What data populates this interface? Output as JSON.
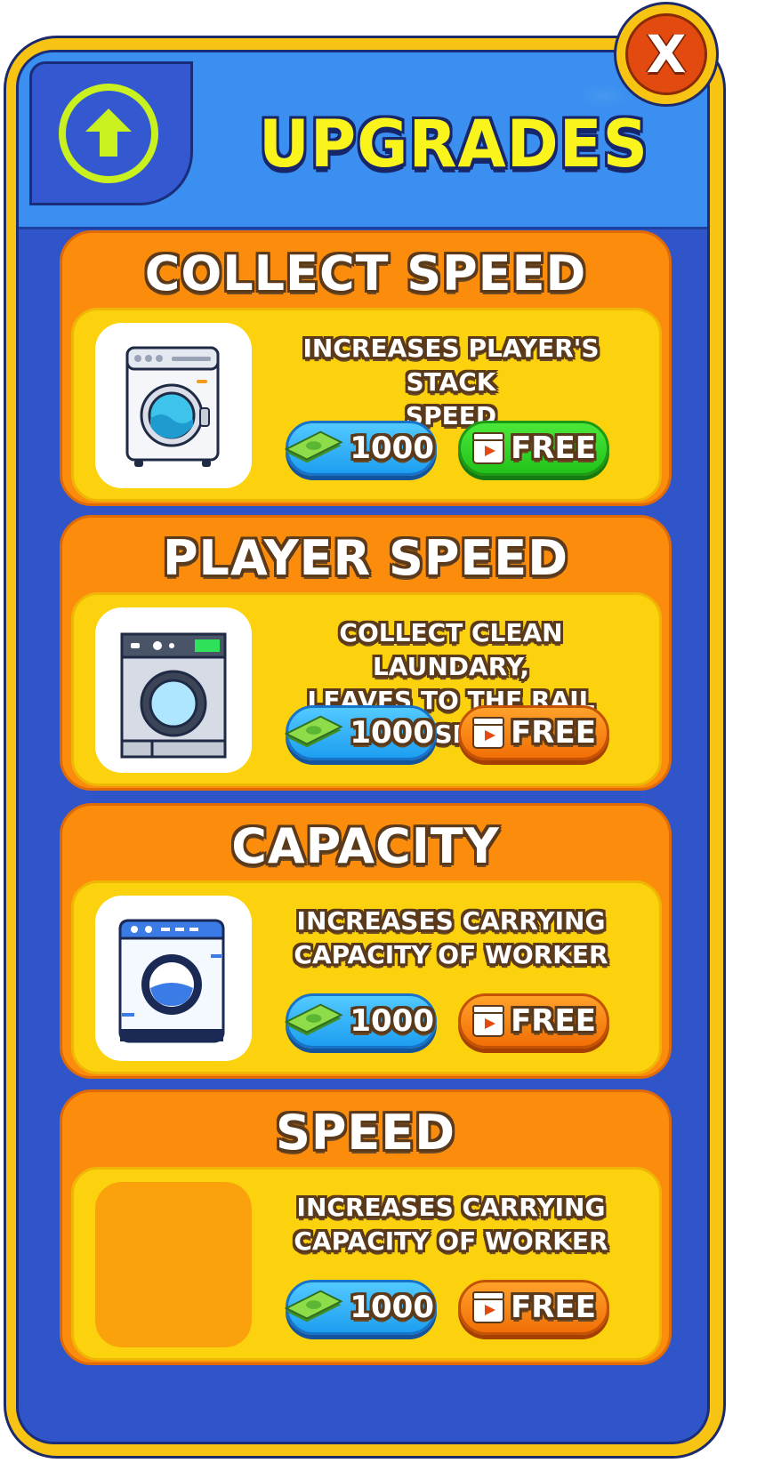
{
  "header": {
    "title": "UPGRADES",
    "tab_icon": "upgrade-arrow-icon",
    "close_label": "X"
  },
  "cards": [
    {
      "title": "COLLECT SPEED",
      "description_lines": [
        "INCREASES PLAYER'S STACK",
        "SPEED"
      ],
      "thumb_icon": "washing-machine-gray-icon",
      "cost": "1000",
      "free_label": "FREE",
      "free_button_color": "green"
    },
    {
      "title": "PLAYER SPEED",
      "description_lines": [
        "COLLECT CLEAN LAUNDARY,",
        "LEAVES TO THE RAIL BASKET"
      ],
      "thumb_icon": "washing-machine-dark-icon",
      "cost": "1000",
      "free_label": "FREE",
      "free_button_color": "orange"
    },
    {
      "title": "CAPACITY",
      "description_lines": [
        "INCREASES CARRYING",
        "CAPACITY OF WORKER"
      ],
      "thumb_icon": "washing-machine-blue-icon",
      "cost": "1000",
      "free_label": "FREE",
      "free_button_color": "orange"
    },
    {
      "title": "SPEED",
      "description_lines": [
        "INCREASES CARRYING",
        "CAPACITY OF WORKER"
      ],
      "thumb_icon": "empty-thumbnail",
      "cost": "1000",
      "free_label": "FREE",
      "free_button_color": "orange"
    }
  ],
  "colors": {
    "frame": "#f7c414",
    "panel": "#2f55c8",
    "header": "#3a8ff0",
    "title": "#f9f41b",
    "card": "#fb8c0c",
    "card_body": "#fbd20d",
    "cost_button": "#1d9ef0",
    "free_button_orange": "#f16f06",
    "free_button_green": "#22c21a",
    "close_button": "#e24a0f"
  }
}
